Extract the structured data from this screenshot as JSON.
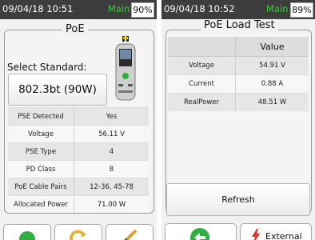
{
  "left_screen": {
    "status": {
      "time": "09/04/18 10:51",
      "mode": "Main",
      "battery": "90%"
    },
    "title": "PoE",
    "select_label": "Select Standard:",
    "select_value": "802.3bt (90W)",
    "rows": [
      {
        "label": "PSE Detected",
        "value": "Yes"
      },
      {
        "label": "Voltage",
        "value": "56.11 V"
      },
      {
        "label": "PSE Type",
        "value": "4"
      },
      {
        "label": "PD Class",
        "value": "8"
      },
      {
        "label": "PoE Cable Pairs",
        "value": "12-36, 45-78"
      },
      {
        "label": "Allocated Power",
        "value": "71.00 W"
      }
    ]
  },
  "right_screen": {
    "status": {
      "time": "09/04/18 10:52",
      "mode": "Main",
      "battery": "89%"
    },
    "title": "PoE Load Test",
    "column_header": "Value",
    "rows": [
      {
        "label": "Voltage",
        "value": "54.91 V"
      },
      {
        "label": "Current",
        "value": "0.88 A"
      },
      {
        "label": "RealPower",
        "value": "48.51 W"
      }
    ],
    "refresh_label": "Refresh",
    "external_label": "External"
  },
  "colors": {
    "status_bar": "#3d3d3d",
    "mode_text": "#3ccb3c",
    "accent_green": "#2fb040",
    "lightning_red": "#e0302a"
  }
}
